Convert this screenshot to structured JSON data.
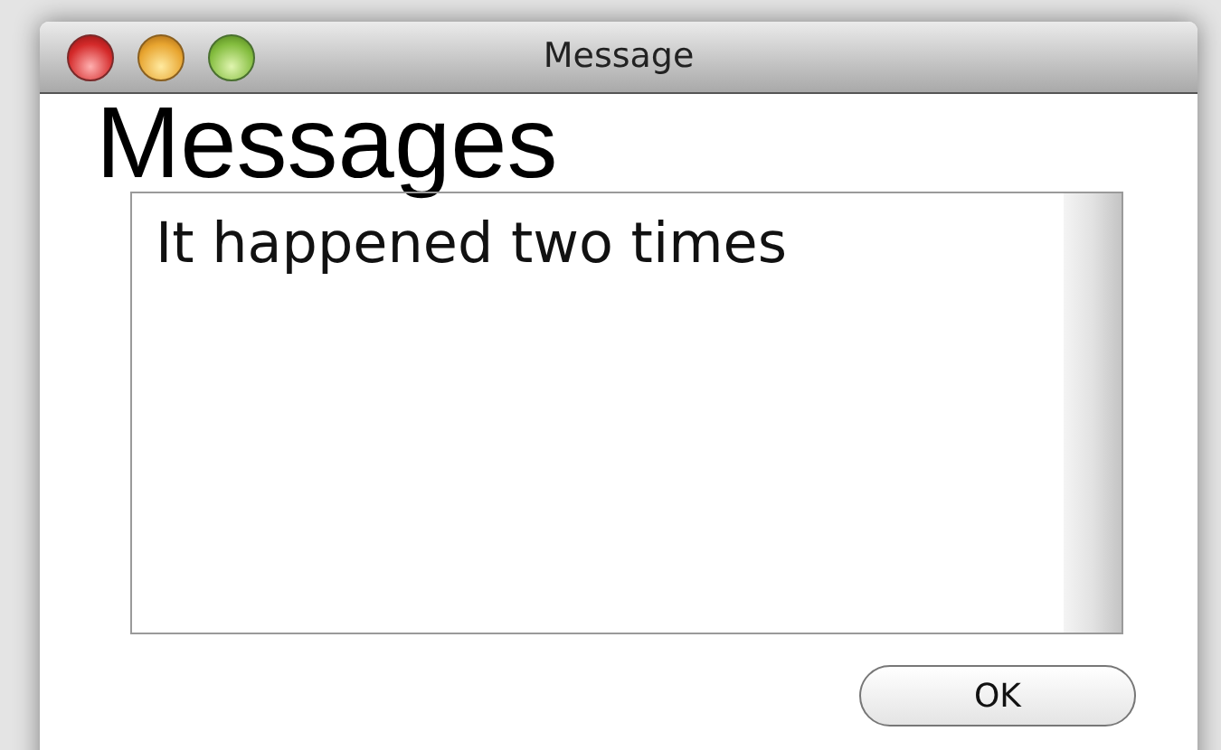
{
  "window": {
    "title": "Message"
  },
  "heading": "Messages",
  "message_area": {
    "text": "It happened two times"
  },
  "buttons": [
    "OK"
  ]
}
